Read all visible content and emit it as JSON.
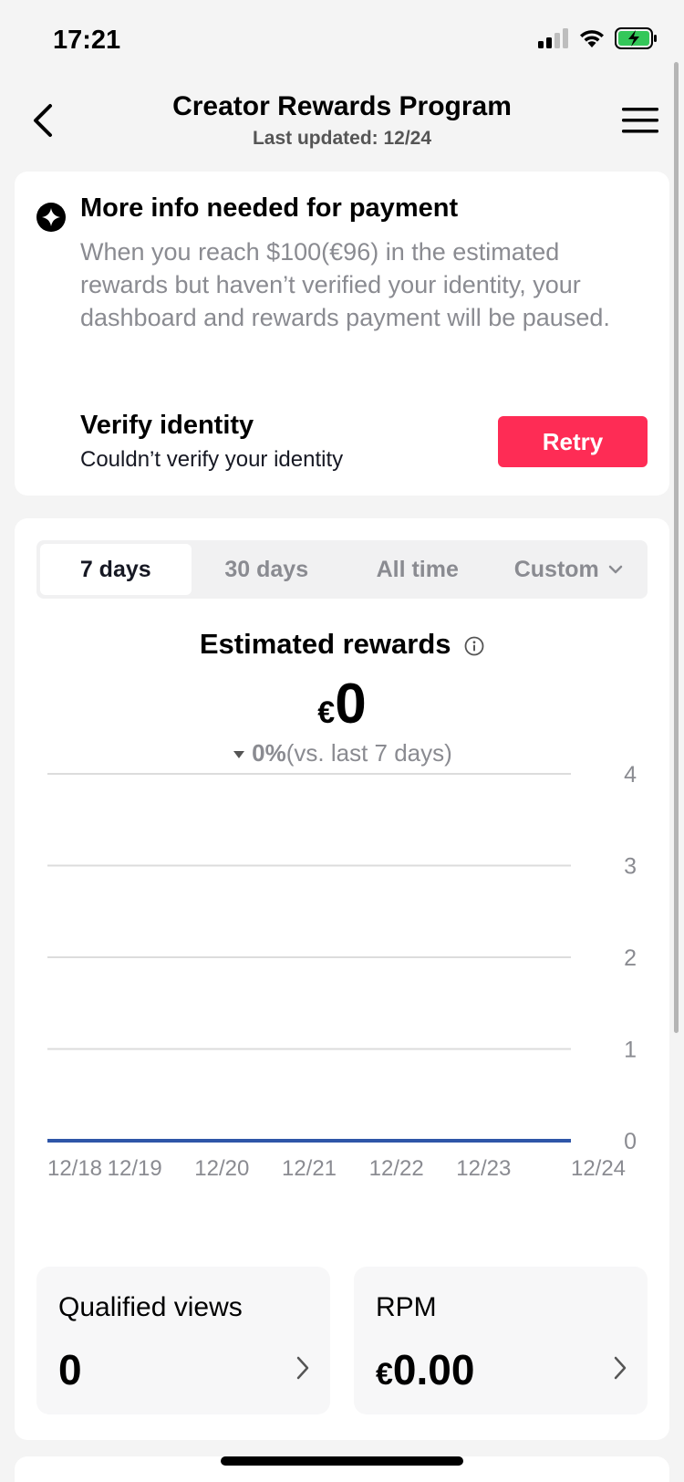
{
  "status": {
    "time": "17:21"
  },
  "nav": {
    "title": "Creator Rewards Program",
    "subtitle": "Last updated: 12/24"
  },
  "notice": {
    "title": "More info needed for payment",
    "body": "When you reach $100(€96) in the estimated rewards but haven’t verified your identity, your dashboard and rewards payment will be paused.",
    "verify_title": "Verify identity",
    "verify_sub": "Couldn’t verify your identity",
    "retry_label": "Retry"
  },
  "tabs": [
    "7 days",
    "30 days",
    "All time",
    "Custom"
  ],
  "rewards": {
    "title": "Estimated rewards",
    "currency": "€",
    "value": "0",
    "change_pct": "0%",
    "change_text": "(vs. last 7 days)"
  },
  "chart_data": {
    "type": "line",
    "x": [
      "12/18",
      "12/19",
      "12/20",
      "12/21",
      "12/22",
      "12/23",
      "12/24"
    ],
    "y_ticks": [
      0,
      1,
      2,
      3,
      4
    ],
    "ylim": [
      0,
      4
    ],
    "series": [
      {
        "values": [
          0,
          0,
          0,
          0,
          0,
          0,
          0
        ],
        "color": "#2e56a8"
      }
    ],
    "grid": true
  },
  "stats": {
    "views_label": "Qualified views",
    "views_value": "0",
    "rpm_label": "RPM",
    "rpm_currency": "€",
    "rpm_value": "0.00"
  },
  "colors": {
    "accent": "#fe2c55",
    "line": "#2e56a8"
  }
}
